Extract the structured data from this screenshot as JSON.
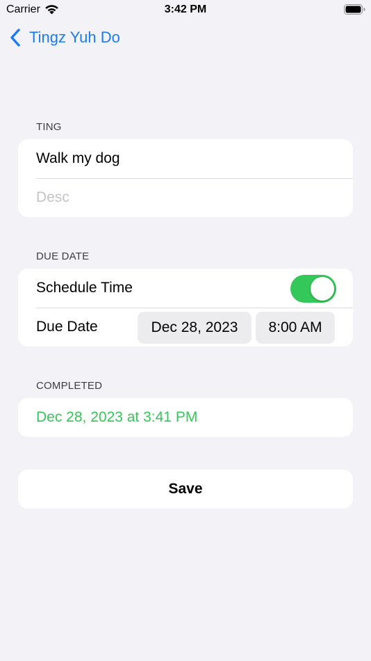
{
  "status_bar": {
    "carrier": "Carrier",
    "time": "3:42 PM"
  },
  "nav": {
    "back_label": "Tingz Yuh Do"
  },
  "ting_section": {
    "header": "TING",
    "title_value": "Walk my dog",
    "desc_placeholder": "Desc"
  },
  "due_section": {
    "header": "DUE DATE",
    "schedule_label": "Schedule Time",
    "schedule_on": true,
    "due_label": "Due Date",
    "date_value": "Dec 28, 2023",
    "time_value": "8:00 AM"
  },
  "completed_section": {
    "header": "COMPLETED",
    "value": "Dec 28, 2023 at 3:41 PM"
  },
  "save_label": "Save",
  "colors": {
    "background": "#f2f2f7",
    "accent_blue": "#1a7bf2",
    "toggle_green": "#34c759",
    "completed_green": "#34c759"
  },
  "icons": [
    "wifi-icon",
    "battery-icon",
    "chevron-left-icon"
  ]
}
